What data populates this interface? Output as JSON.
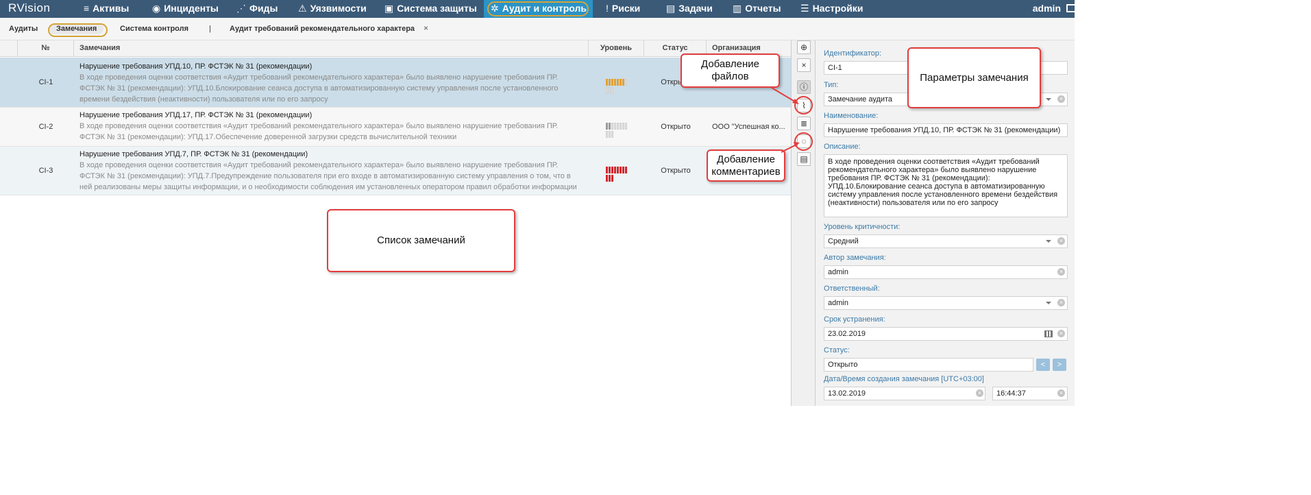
{
  "app": {
    "logo": "RVision",
    "nav": [
      {
        "label": "Активы",
        "icon": "database-icon",
        "glyph": "≡"
      },
      {
        "label": "Инциденты",
        "icon": "target-icon",
        "glyph": "◉"
      },
      {
        "label": "Фиды",
        "icon": "rss-icon",
        "glyph": "⋰"
      },
      {
        "label": "Уязвимости",
        "icon": "warning-icon",
        "glyph": "⚠"
      },
      {
        "label": "Система защиты",
        "icon": "shield-icon",
        "glyph": "▣"
      },
      {
        "label": "Аудит и контроль",
        "icon": "audit-icon",
        "glyph": "✲"
      },
      {
        "label": "Риски",
        "icon": "risk-icon",
        "glyph": "!"
      },
      {
        "label": "Задачи",
        "icon": "tasks-icon",
        "glyph": "▤"
      },
      {
        "label": "Отчеты",
        "icon": "reports-icon",
        "glyph": "▥"
      },
      {
        "label": "Настройки",
        "icon": "settings-icon",
        "glyph": "☰"
      }
    ],
    "user": "admin"
  },
  "subtabs": {
    "items": [
      "Аудиты",
      "Замечания",
      "Система контроля"
    ],
    "separator": "|",
    "open_tab": "Аудит требований рекомендательного характера",
    "close": "×"
  },
  "table": {
    "headers": {
      "num": "№",
      "remarks": "Замечания",
      "level": "Уровень",
      "status": "Статус",
      "org": "Организация"
    },
    "rows": [
      {
        "num": "CI-1",
        "title": "Нарушение требования УПД.10, ПР. ФСТЭК № 31 (рекомендации)",
        "desc": "В ходе проведения оценки соответствия «Аудит требований рекомендательного характера» было выявлено нарушение требования ПР. ФСТЭК № 31 (рекомендации): УПД.10.Блокирование сеанса доступа в автоматизированную систему управления после установленного времени бездействия (неактивности) пользователя или по его запросу",
        "level": 0.6,
        "level_color": "#e3a035",
        "status": "Открыто",
        "org": ""
      },
      {
        "num": "CI-2",
        "title": "Нарушение требования УПД.17, ПР. ФСТЭК № 31 (рекомендации)",
        "desc": "В ходе проведения оценки соответствия «Аудит требований рекомендательного характера» было выявлено нарушение требования ПР. ФСТЭК № 31 (рекомендации): УПД.17.Обеспечение доверенной загрузки средств вычислительной техники",
        "level": 0.2,
        "level_color": "#9a9a9a",
        "status": "Открыто",
        "org": "ООО \"Успешная ко..."
      },
      {
        "num": "CI-3",
        "title": "Нарушение требования УПД.7, ПР. ФСТЭК № 31 (рекомендации)",
        "desc": "В ходе проведения оценки соответствия «Аудит требований рекомендательного характера» было выявлено нарушение требования ПР. ФСТЭК № 31 (рекомендации): УПД.7.Предупреждение пользователя при его входе в автоматизированную систему управления о том, что в ней реализованы меры защиты информации, и о необходимости соблюдения им установленных оператором правил обработки информации",
        "level": 1.0,
        "level_color": "#d2262c",
        "status": "Открыто",
        "org": ""
      }
    ]
  },
  "toolbar": {
    "add": "⊕",
    "remove": "×",
    "info": "ⓘ",
    "attach": "⌇",
    "db": "≣",
    "comment": "◌",
    "clipboard": "▤"
  },
  "form": {
    "id_label": "Идентификатор:",
    "id_value": "CI-1",
    "type_label": "Тип:",
    "type_value": "Замечание аудита",
    "name_label": "Наименование:",
    "name_value": "Нарушение требования УПД.10, ПР. ФСТЭК № 31 (рекомендации)",
    "desc_label": "Описание:",
    "desc_value": "В ходе проведения оценки соответствия «Аудит требований рекомендательного характера» было выявлено нарушение требования ПР. ФСТЭК № 31 (рекомендации): УПД.10.Блокирование сеанса доступа в автоматизированную систему управления после установленного времени бездействия (неактивности) пользователя или по его запросу",
    "crit_label": "Уровень критичности:",
    "crit_value": "Средний",
    "author_label": "Автор замечания:",
    "author_value": "admin",
    "resp_label": "Ответственный:",
    "resp_value": "admin",
    "due_label": "Срок устранения:",
    "due_value": "23.02.2019",
    "status_label": "Статус:",
    "status_value": "Открыто",
    "prev": "<",
    "next": ">",
    "created_label": "Дата/Время создания замечания [UTC+03:00]",
    "created_date": "13.02.2019",
    "created_time": "16:44:37"
  },
  "callouts": {
    "files": "Добавление файлов",
    "comments": "Добавление комментариев",
    "params": "Параметры замечания",
    "list": "Список замечаний"
  },
  "colors": {
    "nav_bg": "#3b5a78",
    "nav_active": "#2b93c6",
    "callout_border": "#e23d3d",
    "highlight_ring": "#d4a437",
    "label_blue": "#3b7aa8"
  }
}
